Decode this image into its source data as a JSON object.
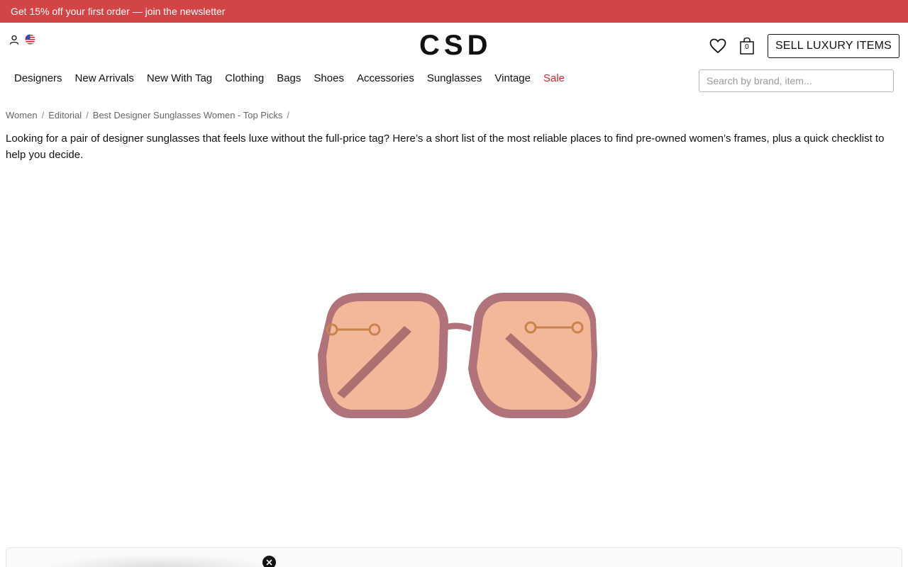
{
  "promo": {
    "text": "Get 15% off your first order — join the newsletter"
  },
  "header": {
    "logo": "CSD",
    "cart_count": "0",
    "sell_button": "SELL LUXURY ITEMS",
    "icons": {
      "account": "user-icon",
      "country": "us-flag-icon",
      "wishlist": "heart-icon",
      "cart": "shopping-bag-icon"
    }
  },
  "nav": {
    "items": [
      {
        "label": "Designers"
      },
      {
        "label": "New Arrivals"
      },
      {
        "label": "New With Tag"
      },
      {
        "label": "Clothing"
      },
      {
        "label": "Bags"
      },
      {
        "label": "Shoes"
      },
      {
        "label": "Accessories"
      },
      {
        "label": "Sunglasses"
      },
      {
        "label": "Vintage"
      },
      {
        "label": "Sale"
      }
    ],
    "sale_color": "#d22630"
  },
  "search": {
    "placeholder": "Search by brand, item..."
  },
  "breadcrumb": {
    "items": [
      {
        "label": "Women"
      },
      {
        "label": "Editorial"
      },
      {
        "label": "Best Designer Sunglasses Women - Top Picks"
      }
    ]
  },
  "article": {
    "intro": "Looking for a pair of designer sunglasses that feels luxe without the full-price tag? Here’s a short list of the most reliable places to find pre-owned women’s frames, plus a quick checklist to help you decide."
  },
  "colors": {
    "promo_bg": "#d24446",
    "frame": "#a9686e",
    "lens": "#f3b79a"
  }
}
